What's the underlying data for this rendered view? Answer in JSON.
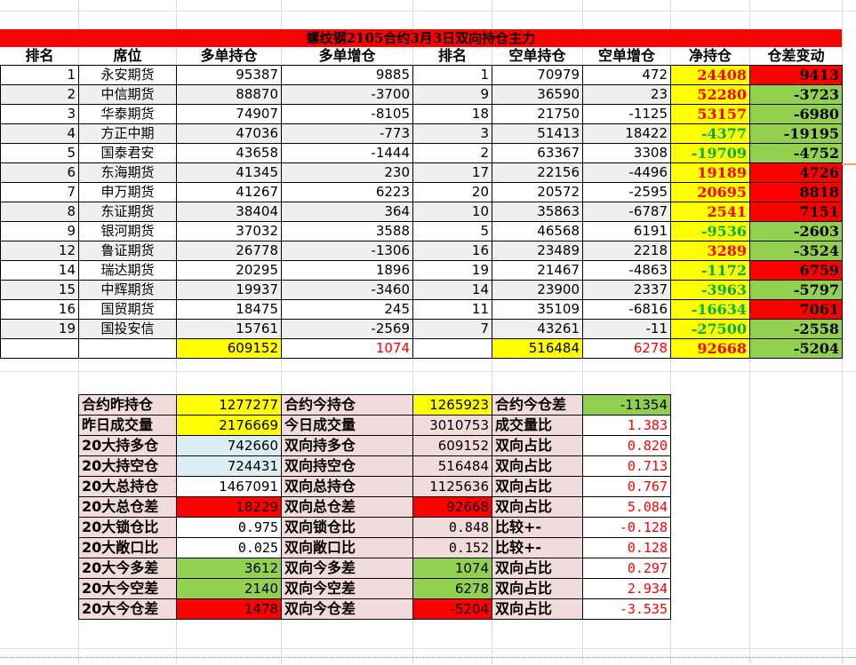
{
  "title": "螺纹钢2105合约3月3日双向持仓主力",
  "headers": [
    "排名",
    "席位",
    "多单持仓",
    "多单增仓",
    "排名",
    "空单持仓",
    "空单增仓",
    "净持仓",
    "仓差变动"
  ],
  "rows": [
    {
      "long_rank": "1",
      "seat": "永安期货",
      "long_pos": "95387",
      "long_chg": "9885",
      "short_rank": "1",
      "short_pos": "70979",
      "short_chg": "472",
      "net": "24408",
      "diff": "9413"
    },
    {
      "long_rank": "2",
      "seat": "中信期货",
      "long_pos": "88870",
      "long_chg": "-3700",
      "short_rank": "9",
      "short_pos": "36590",
      "short_chg": "23",
      "net": "52280",
      "diff": "-3723"
    },
    {
      "long_rank": "3",
      "seat": "华泰期货",
      "long_pos": "74907",
      "long_chg": "-8105",
      "short_rank": "18",
      "short_pos": "21750",
      "short_chg": "-1125",
      "net": "53157",
      "diff": "-6980"
    },
    {
      "long_rank": "4",
      "seat": "方正中期",
      "long_pos": "47036",
      "long_chg": "-773",
      "short_rank": "3",
      "short_pos": "51413",
      "short_chg": "18422",
      "net": "-4377",
      "diff": "-19195"
    },
    {
      "long_rank": "5",
      "seat": "国泰君安",
      "long_pos": "43658",
      "long_chg": "-1444",
      "short_rank": "2",
      "short_pos": "63367",
      "short_chg": "3308",
      "net": "-19709",
      "diff": "-4752"
    },
    {
      "long_rank": "6",
      "seat": "东海期货",
      "long_pos": "41345",
      "long_chg": "230",
      "short_rank": "17",
      "short_pos": "22156",
      "short_chg": "-4496",
      "net": "19189",
      "diff": "4726"
    },
    {
      "long_rank": "7",
      "seat": "申万期货",
      "long_pos": "41267",
      "long_chg": "6223",
      "short_rank": "20",
      "short_pos": "20572",
      "short_chg": "-2595",
      "net": "20695",
      "diff": "8818"
    },
    {
      "long_rank": "8",
      "seat": "东证期货",
      "long_pos": "38404",
      "long_chg": "364",
      "short_rank": "10",
      "short_pos": "35863",
      "short_chg": "-6787",
      "net": "2541",
      "diff": "7151"
    },
    {
      "long_rank": "9",
      "seat": "银河期货",
      "long_pos": "37032",
      "long_chg": "3588",
      "short_rank": "5",
      "short_pos": "46568",
      "short_chg": "6191",
      "net": "-9536",
      "diff": "-2603"
    },
    {
      "long_rank": "12",
      "seat": "鲁证期货",
      "long_pos": "26778",
      "long_chg": "-1306",
      "short_rank": "16",
      "short_pos": "23489",
      "short_chg": "2218",
      "net": "3289",
      "diff": "-3524"
    },
    {
      "long_rank": "14",
      "seat": "瑞达期货",
      "long_pos": "20295",
      "long_chg": "1896",
      "short_rank": "19",
      "short_pos": "21467",
      "short_chg": "-4863",
      "net": "-1172",
      "diff": "6759"
    },
    {
      "long_rank": "15",
      "seat": "中辉期货",
      "long_pos": "19937",
      "long_chg": "-3460",
      "short_rank": "14",
      "short_pos": "23900",
      "short_chg": "2337",
      "net": "-3963",
      "diff": "-5797"
    },
    {
      "long_rank": "16",
      "seat": "国贸期货",
      "long_pos": "18475",
      "long_chg": "245",
      "short_rank": "11",
      "short_pos": "35109",
      "short_chg": "-6816",
      "net": "-16634",
      "diff": "7061"
    },
    {
      "long_rank": "19",
      "seat": "国投安信",
      "long_pos": "15761",
      "long_chg": "-2569",
      "short_rank": "7",
      "short_pos": "43261",
      "short_chg": "-11",
      "net": "-27500",
      "diff": "-2558"
    }
  ],
  "totals": {
    "long_pos": "609152",
    "long_chg": "1074",
    "short_pos": "516484",
    "short_chg": "6278",
    "net": "92668",
    "diff": "-5204"
  },
  "stats": [
    {
      "l1": "合约昨持仓",
      "v1": "1277277",
      "l2": "合约今持仓",
      "v2": "1265923",
      "l3": "合约今仓差",
      "v3": "-11354"
    },
    {
      "l1": "昨日成交量",
      "v1": "2176669",
      "l2": "今日成交量",
      "v2": "3010753",
      "l3": "成交量比",
      "v3": "1.383"
    },
    {
      "l1": "20大持多仓",
      "v1": "742660",
      "l2": "双向持多仓",
      "v2": "609152",
      "l3": "双向占比",
      "v3": "0.820"
    },
    {
      "l1": "20大持空仓",
      "v1": "724431",
      "l2": "双向持空仓",
      "v2": "516484",
      "l3": "双向占比",
      "v3": "0.713"
    },
    {
      "l1": "20大总持仓",
      "v1": "1467091",
      "l2": "双向总持仓",
      "v2": "1125636",
      "l3": "双向占比",
      "v3": "0.767"
    },
    {
      "l1": "20大总仓差",
      "v1": "18229",
      "l2": "双向总仓差",
      "v2": "92668",
      "l3": "双向占比",
      "v3": "5.084"
    },
    {
      "l1": "20大锁仓比",
      "v1": "0.975",
      "l2": "双向锁仓比",
      "v2": "0.848",
      "l3": "比较+-",
      "v3": "-0.128"
    },
    {
      "l1": "20大敞口比",
      "v1": "0.025",
      "l2": "双向敞口比",
      "v2": "0.152",
      "l3": "比较+-",
      "v3": "0.128"
    },
    {
      "l1": "20大今多差",
      "v1": "3612",
      "l2": "双向今多差",
      "v2": "1074",
      "l3": "双向占比",
      "v3": "0.297"
    },
    {
      "l1": "20大今空差",
      "v1": "2140",
      "l2": "双向今空差",
      "v2": "6278",
      "l3": "双向占比",
      "v3": "2.934"
    },
    {
      "l1": "20大今仓差",
      "v1": "1478",
      "l2": "双向今仓差",
      "v2": "-5204",
      "l3": "双向占比",
      "v3": "-3.535"
    }
  ],
  "colors": {
    "yellow": "#ffff00",
    "red": "#ff0000",
    "green": "#92d050",
    "pink": "#f2dcdb",
    "light_blue": "#daeef3",
    "text_red": "#ff0000",
    "text_green": "#00b050"
  }
}
